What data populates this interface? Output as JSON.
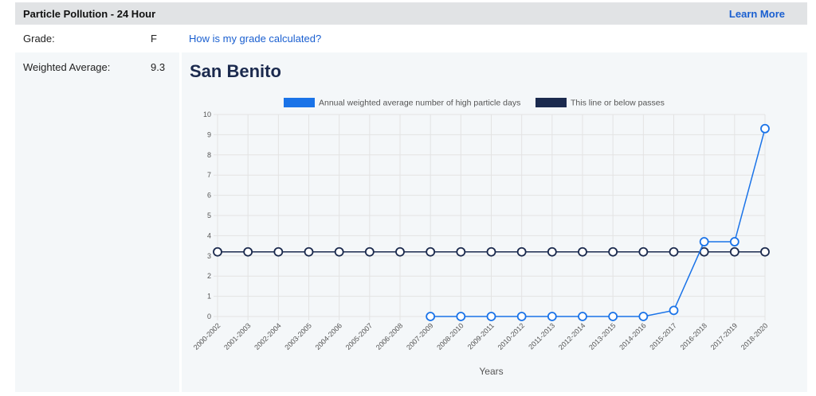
{
  "header": {
    "title": "Particle Pollution - 24 Hour",
    "learn_more": "Learn More"
  },
  "grade": {
    "label": "Grade:",
    "value": "F",
    "link": "How is my grade calculated?"
  },
  "weighted": {
    "label": "Weighted Average:",
    "value": "9.3"
  },
  "colors": {
    "series_blue": "#1a73e8",
    "series_navy": "#1b2a4e",
    "grid": "#e3e3e3"
  },
  "chart_data": {
    "type": "line",
    "title": "San Benito",
    "xlabel": "Years",
    "ylabel": "",
    "ylim": [
      0,
      10
    ],
    "yticks": [
      0,
      1,
      2,
      3,
      4,
      5,
      6,
      7,
      8,
      9,
      10
    ],
    "grid": true,
    "legend_placement": "top-center",
    "categories": [
      "2000-2002",
      "2001-2003",
      "2002-2004",
      "2003-2005",
      "2004-2006",
      "2005-2007",
      "2006-2008",
      "2007-2009",
      "2008-2010",
      "2009-2011",
      "2010-2012",
      "2011-2013",
      "2012-2014",
      "2013-2015",
      "2014-2016",
      "2015-2017",
      "2016-2018",
      "2017-2019",
      "2018-2020"
    ],
    "series": [
      {
        "name": "Annual weighted average number of high particle days",
        "color": "#1a73e8",
        "values": [
          null,
          null,
          null,
          null,
          null,
          null,
          null,
          0,
          0,
          0,
          0,
          0,
          0,
          0,
          0,
          0.3,
          3.7,
          3.7,
          9.3
        ]
      },
      {
        "name": "This line or below passes",
        "color": "#1b2a4e",
        "values": [
          3.2,
          3.2,
          3.2,
          3.2,
          3.2,
          3.2,
          3.2,
          3.2,
          3.2,
          3.2,
          3.2,
          3.2,
          3.2,
          3.2,
          3.2,
          3.2,
          3.2,
          3.2,
          3.2
        ]
      }
    ]
  }
}
